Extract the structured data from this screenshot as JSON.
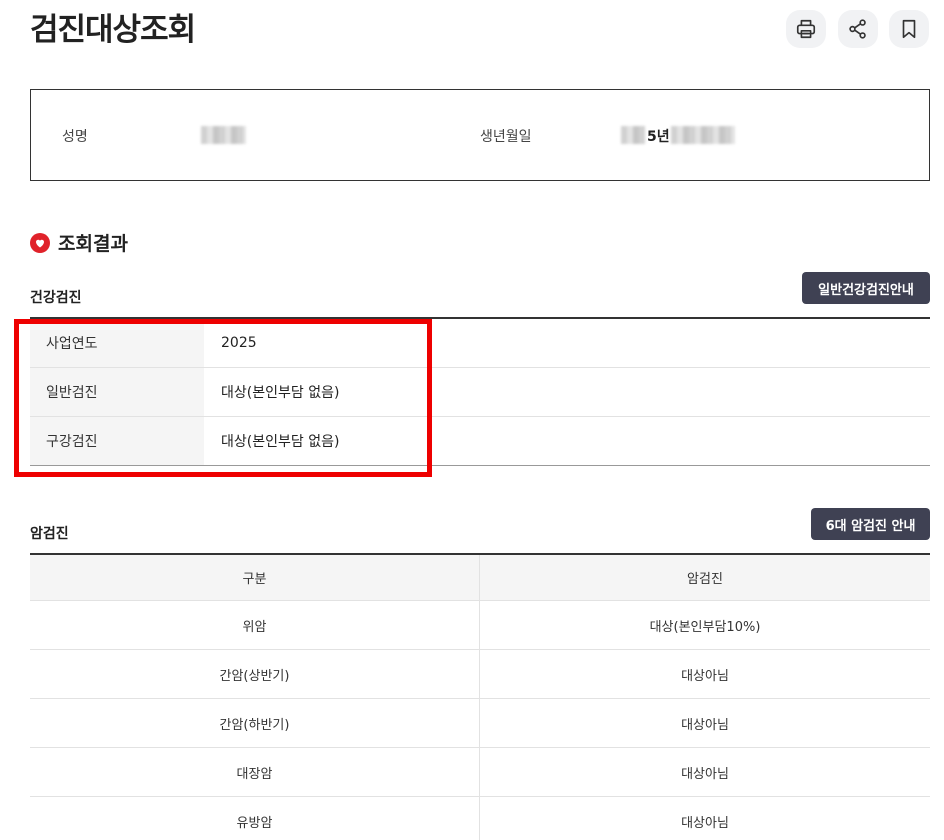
{
  "page": {
    "title": "검진대상조회"
  },
  "toolbar": {
    "print_icon": "printer-icon",
    "share_icon": "share-icon",
    "bookmark_icon": "bookmark-icon"
  },
  "person": {
    "name_label": "성명",
    "birth_label": "생년월일",
    "birth_visible_fragment": "5년"
  },
  "result": {
    "heading": "조회결과",
    "heading_icon": "heart-icon"
  },
  "health_checkup": {
    "title": "건강검진",
    "guide_button": "일반건강검진안내",
    "rows": [
      {
        "label": "사업연도",
        "value": "2025"
      },
      {
        "label": "일반검진",
        "value": "대상(본인부담 없음)"
      },
      {
        "label": "구강검진",
        "value": "대상(본인부담 없음)"
      }
    ]
  },
  "cancer_checkup": {
    "title": "암검진",
    "guide_button": "6대 암검진 안내",
    "headers": [
      "구분",
      "암검진"
    ],
    "rows": [
      {
        "type": "위암",
        "status": "대상(본인부담10%)"
      },
      {
        "type": "간암(상반기)",
        "status": "대상아님"
      },
      {
        "type": "간암(하반기)",
        "status": "대상아님"
      },
      {
        "type": "대장암",
        "status": "대상아님"
      },
      {
        "type": "유방암",
        "status": "대상아님"
      }
    ]
  },
  "colors": {
    "accent_red": "#e0222a",
    "highlight_red": "#ee0000",
    "button_dark": "#3f4153"
  }
}
